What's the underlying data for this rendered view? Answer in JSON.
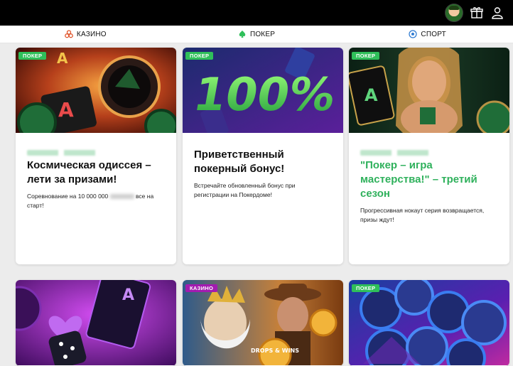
{
  "nav": {
    "casino": "КАЗИНО",
    "poker": "ПОКЕР",
    "sport": "СПОРТ"
  },
  "icons": {
    "account": "user-icon",
    "gift": "gift-icon",
    "avatar": "avatar"
  },
  "colors": {
    "poker_badge": "#2fbf5a",
    "casino_badge": "#a21bb0",
    "accent_green": "#2fb15c"
  },
  "cards": [
    {
      "badge": "ПОКЕР",
      "title": "Космическая одиссея – лети за призами!",
      "description_before": "Соревнование на 10 000 000",
      "description_after": "все на старт!"
    },
    {
      "badge": "ПОКЕР",
      "image_text": "100%",
      "title": "Приветственный покерный бонус!",
      "description": "Встречайте обновленный бонус при регистрации на Покердоме!"
    },
    {
      "badge": "ПОКЕР",
      "title": "\"Покер – игра мастерства!\" – третий сезон",
      "description": "Прогрессивная нокаут серия возвращается, призы ждут!"
    },
    {
      "badge": ""
    },
    {
      "badge": "КАЗИНО",
      "image_text": "DROPS & WINS"
    },
    {
      "badge": "ПОКЕР"
    }
  ]
}
